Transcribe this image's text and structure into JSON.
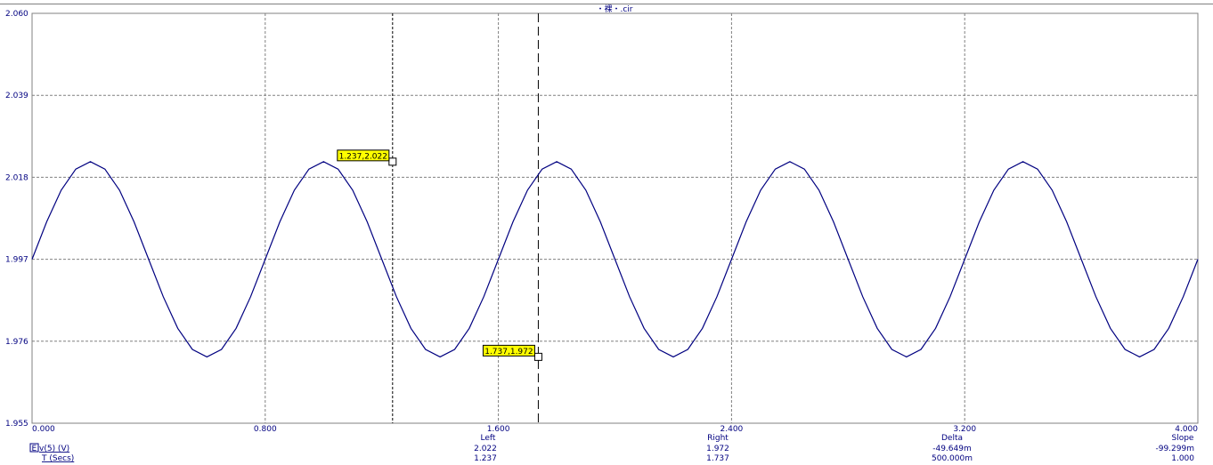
{
  "title": "・裸・.cir",
  "chart_data": {
    "type": "line",
    "xlim": [
      0.0,
      4.0
    ],
    "ylim": [
      1.955,
      2.06
    ],
    "x_ticks": [
      "0.000",
      "0.800",
      "1.600",
      "2.400",
      "3.200",
      "4.000"
    ],
    "x_tick_values": [
      0.0,
      0.8,
      1.6,
      2.4,
      3.2,
      4.0
    ],
    "y_ticks": [
      "2.060",
      "2.039",
      "2.018",
      "1.997",
      "1.976",
      "1.955"
    ],
    "y_tick_values": [
      2.06,
      2.039,
      2.018,
      1.997,
      1.976,
      1.955
    ],
    "grid": true,
    "series": [
      {
        "name": "v(5) (V)",
        "color": "#000080",
        "x": [
          0.0,
          0.05,
          0.1,
          0.15,
          0.2,
          0.25,
          0.3,
          0.35,
          0.4,
          0.45,
          0.5,
          0.55,
          0.6,
          0.65,
          0.7,
          0.75,
          0.8,
          0.85,
          0.9,
          0.95,
          1.0,
          1.05,
          1.1,
          1.15,
          1.2,
          1.25,
          1.3,
          1.35,
          1.4,
          1.45,
          1.5,
          1.55,
          1.6,
          1.65,
          1.7,
          1.75,
          1.8,
          1.85,
          1.9,
          1.95,
          2.0,
          2.05,
          2.1,
          2.15,
          2.2,
          2.25,
          2.3,
          2.35,
          2.4,
          2.45,
          2.5,
          2.55,
          2.6,
          2.65,
          2.7,
          2.75,
          2.8,
          2.85,
          2.9,
          2.95,
          3.0,
          3.05,
          3.1,
          3.15,
          3.2,
          3.25,
          3.3,
          3.35,
          3.4,
          3.45,
          3.5,
          3.55,
          3.6,
          3.65,
          3.7,
          3.75,
          3.8,
          3.85,
          3.9,
          3.95,
          4.0
        ],
        "y": [
          1.997,
          2.0066,
          2.0147,
          2.0201,
          2.022,
          2.0201,
          2.0147,
          2.0066,
          1.997,
          1.9874,
          1.9793,
          1.9739,
          1.972,
          1.9739,
          1.9793,
          1.9874,
          1.997,
          2.0066,
          2.0147,
          2.0201,
          2.022,
          2.0201,
          2.0147,
          2.0066,
          1.997,
          1.9874,
          1.9793,
          1.9739,
          1.972,
          1.9739,
          1.9793,
          1.9874,
          1.997,
          2.0066,
          2.0147,
          2.0201,
          2.022,
          2.0201,
          2.0147,
          2.0066,
          1.997,
          1.9874,
          1.9793,
          1.9739,
          1.972,
          1.9739,
          1.9793,
          1.9874,
          1.997,
          2.0066,
          2.0147,
          2.0201,
          2.022,
          2.0201,
          2.0147,
          2.0066,
          1.997,
          1.9874,
          1.9793,
          1.9739,
          1.972,
          1.9739,
          1.9793,
          1.9874,
          1.997,
          2.0066,
          2.0147,
          2.0201,
          2.022,
          2.0201,
          2.0147,
          2.0066,
          1.997,
          1.9874,
          1.9793,
          1.9739,
          1.972,
          1.9739,
          1.9793,
          1.9874,
          1.997
        ]
      }
    ],
    "cursors": [
      {
        "x": 1.237,
        "y": 2.022,
        "label": "1.237,2.022",
        "style": "dashed-fine"
      },
      {
        "x": 1.737,
        "y": 1.972,
        "label": "1.737,1.972",
        "style": "dashed-long"
      }
    ]
  },
  "footer": {
    "headers": {
      "left": "Left",
      "right": "Right",
      "delta": "Delta",
      "slope": "Slope"
    },
    "rows": [
      {
        "icon": "E",
        "label": "v(5) (V)",
        "left": "2.022",
        "right": "1.972",
        "delta": "-49.649m",
        "slope": "-99.299m"
      },
      {
        "icon": "",
        "label": "T (Secs)",
        "left": "1.237",
        "right": "1.737",
        "delta": "500.000m",
        "slope": "1.000"
      }
    ]
  }
}
